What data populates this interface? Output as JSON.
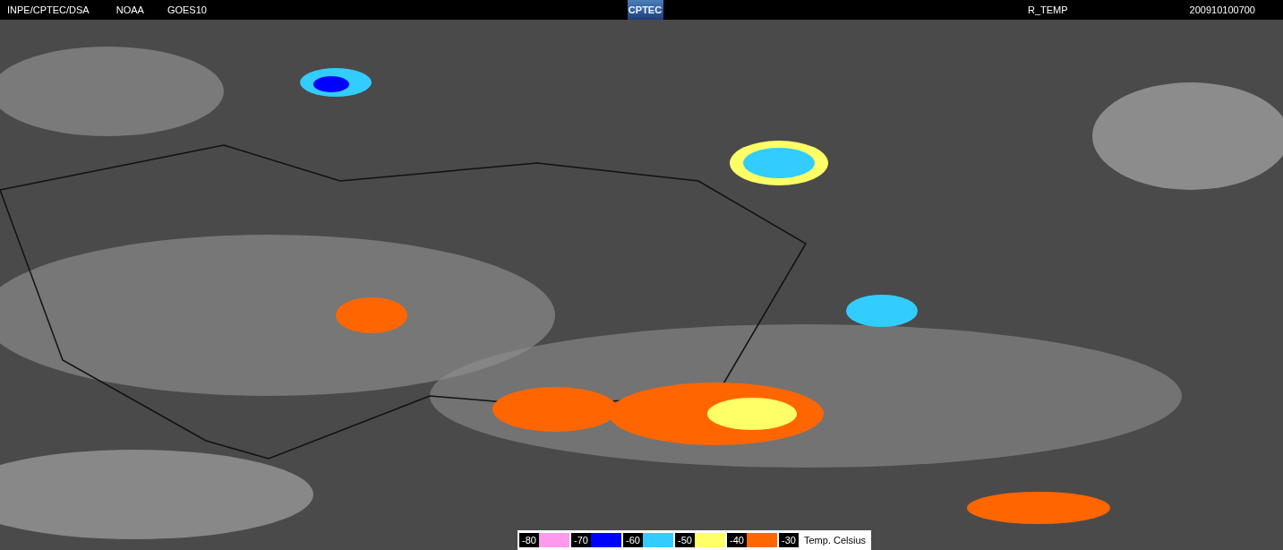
{
  "header": {
    "agency": "INPE/CPTEC/DSA",
    "source": "NOAA",
    "satellite": "GOES10",
    "product": "R_TEMP",
    "timestamp": "200910100700",
    "logo": "CPTEC"
  },
  "legend": {
    "levels": [
      {
        "label": "-80",
        "color": "#ff99ee"
      },
      {
        "label": "-70",
        "color": "#0000ff"
      },
      {
        "label": "-60",
        "color": "#33ccff"
      },
      {
        "label": "-50",
        "color": "#ffff66"
      },
      {
        "label": "-40",
        "color": "#ff6600"
      },
      {
        "label": "-30"
      }
    ],
    "unit": "Temp. Celsius"
  }
}
